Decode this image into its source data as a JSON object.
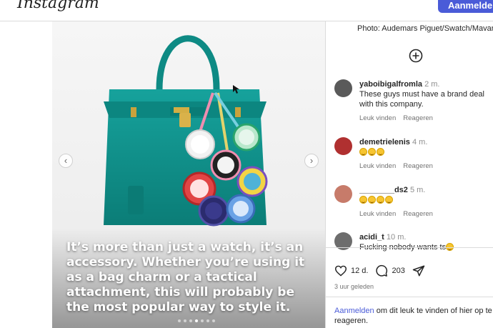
{
  "header": {
    "logo": "Instagram",
    "login_label": "Aanmelden"
  },
  "post": {
    "caption_overlay": "It’s more than just a watch, it’s an accessory. Whether you’re using it as a bag charm or a tactical attachment, this will probably be the most popular way to style it.",
    "credit": "Photo: Audemars Piguet/Swatch/Mavan",
    "carousel_count": 7,
    "carousel_active": 3
  },
  "comments": [
    {
      "user": "yaboibigalfromla",
      "time": "2 m.",
      "text": "These guys must have a brand deal with this company.",
      "emoji_count": 0,
      "like_label": "Leuk vinden",
      "reply_label": "Reageren",
      "avatar_color": "#5a5a5a"
    },
    {
      "user": "demetrielenis",
      "time": "4 m.",
      "text": "",
      "emoji_count": 3,
      "like_label": "Leuk vinden",
      "reply_label": "Reageren",
      "avatar_color": "#b03030"
    },
    {
      "user": "________ds2",
      "time": "5 m.",
      "text": "",
      "emoji_count": 4,
      "like_label": "Leuk vinden",
      "reply_label": "Reageren",
      "avatar_color": "#c77b6a"
    },
    {
      "user": "acidi_t",
      "time": "10 m.",
      "text": "Fucking nobody wants ts",
      "emoji_count": 1,
      "like_label": "",
      "reply_label": "",
      "avatar_color": "#6d6d6d"
    }
  ],
  "stats": {
    "likes": "12 d.",
    "comments": "203",
    "posted_ago": "3 uur geleden"
  },
  "login_prompt": {
    "link": "Aanmelden",
    "text": " om dit leuk te vinden of hier op te reageren."
  },
  "colors": {
    "accent": "#4a5bd8",
    "bag": "#0f8f8a"
  }
}
